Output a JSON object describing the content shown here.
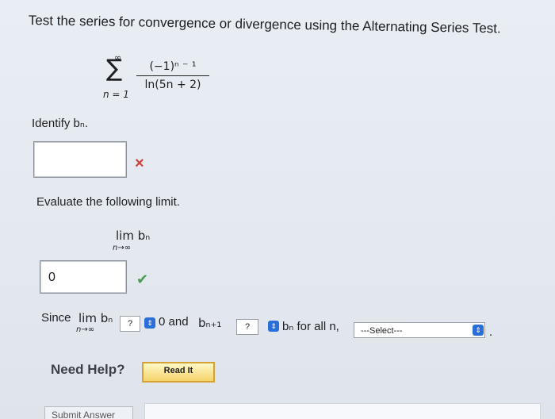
{
  "question": {
    "title": "Test the series for convergence or divergence using the Alternating Series Test."
  },
  "series": {
    "upper": "∞",
    "sigma": "∑",
    "lower": "n = 1",
    "numerator": "(−1)ⁿ ⁻ ¹",
    "denominator": "ln(5n + 2)"
  },
  "part1": {
    "prompt": "Identify bₙ.",
    "answer_value": "",
    "status_icon": "×"
  },
  "part2": {
    "prompt": "Evaluate the following limit.",
    "lim_text": "lim bₙ",
    "lim_sub": "n→∞",
    "answer_value": "0",
    "status_icon": "✔"
  },
  "part3": {
    "since": "Since",
    "lim_text": "lim bₙ",
    "lim_sub": "n→∞",
    "select1": "?",
    "zero_and": "0 and",
    "bn1_text": "bₙ₊₁",
    "select2": "?",
    "bn_for_all": "bₙ for all n,",
    "select3": "---Select---",
    "period": "."
  },
  "help": {
    "label": "Need Help?",
    "read_button": "Read It"
  },
  "submit": {
    "label": "Submit Answer"
  },
  "icons": {
    "spinner": "⇕"
  },
  "colors": {
    "error": "#d0423f",
    "correct": "#4a9a58",
    "select_blue": "#2a6fd8",
    "read_button_border": "#d6a233"
  }
}
